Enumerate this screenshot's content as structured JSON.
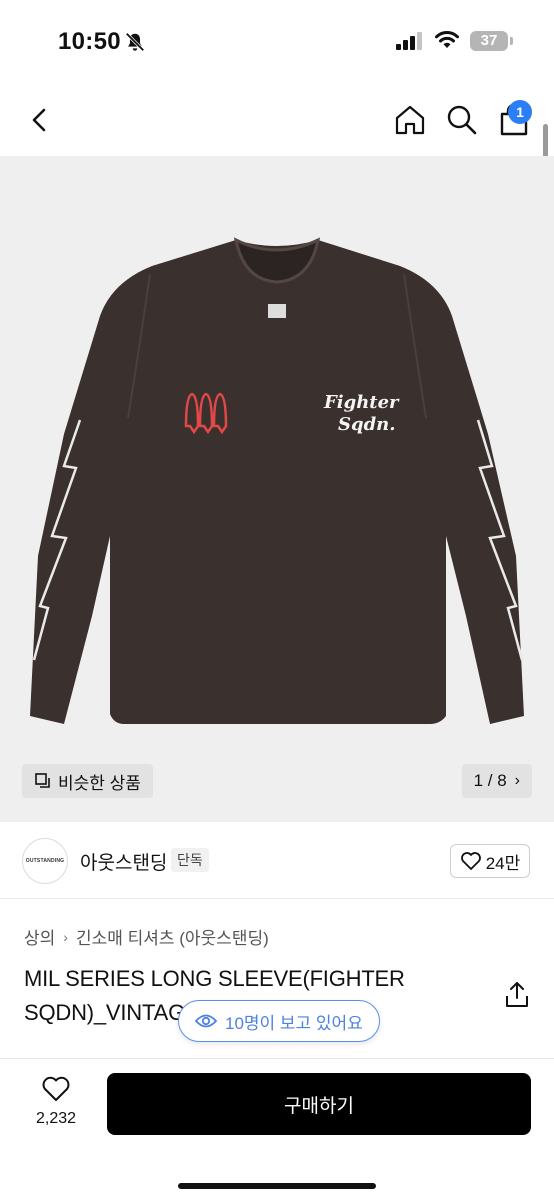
{
  "status_bar": {
    "time": "10:50",
    "battery": "37"
  },
  "nav": {
    "cart_count": "1"
  },
  "gallery": {
    "similar_label": "비슷한 상품",
    "counter": "1 / 8",
    "shirt_print_line1": "Fighter",
    "shirt_print_line2": "Sqdn."
  },
  "brand": {
    "logo_text": "OUTSTANDING",
    "name": "아웃스탠딩",
    "tag": "단독",
    "likes": "24만"
  },
  "breadcrumb": {
    "level1": "상의",
    "level2": "긴소매 티셔츠 (아웃스탠딩)"
  },
  "product": {
    "title": "MIL SERIES LONG SLEEVE(FIGHTER SQDN)_VINTAGE ",
    "viewers": "10명이 보고 있어요"
  },
  "bottom_bar": {
    "wish_count": "2,232",
    "buy_label": "구매하기"
  },
  "colors": {
    "accent": "#2b7ef5",
    "shirt": "#3a302d",
    "buy_button": "#000000"
  }
}
